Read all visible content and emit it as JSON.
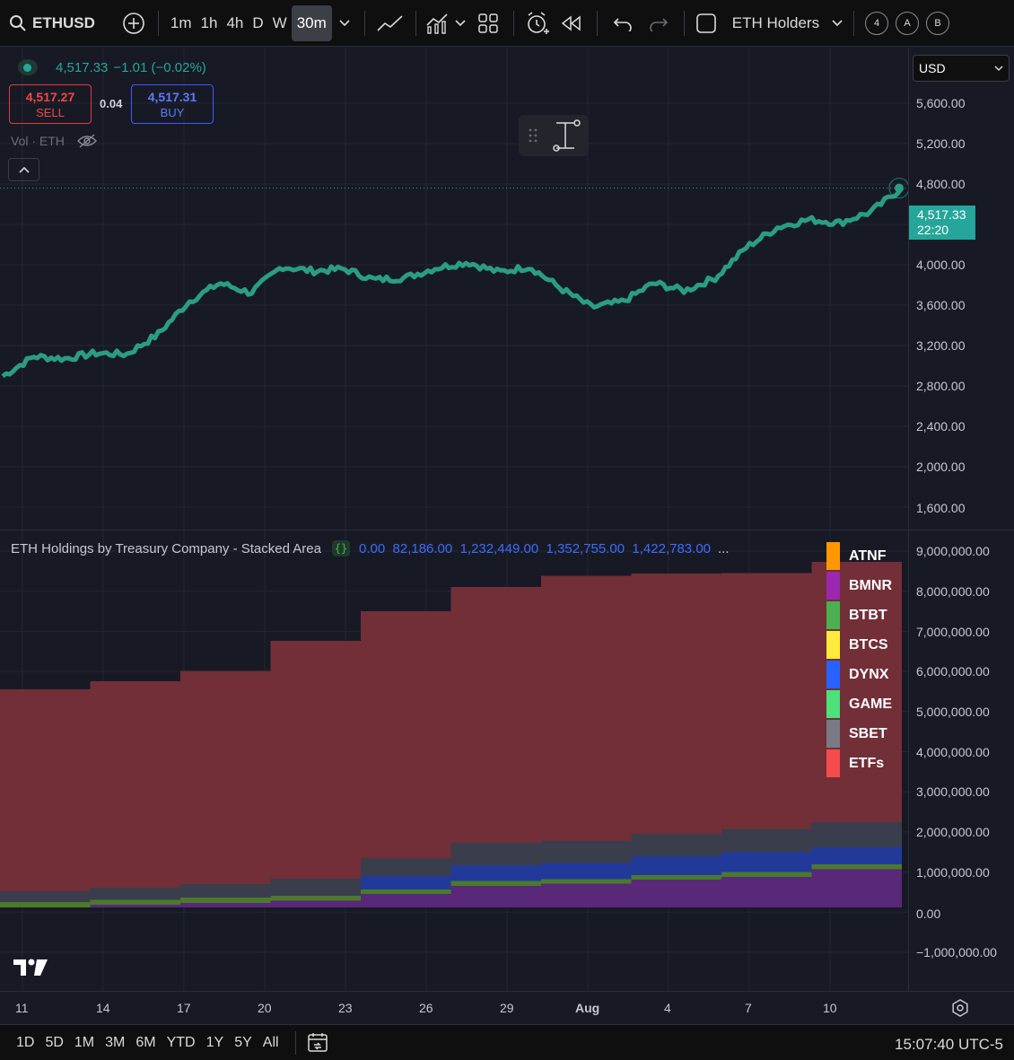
{
  "toolbar": {
    "symbol": "ETHUSD",
    "timeframes": [
      "1m",
      "1h",
      "4h",
      "D",
      "W",
      "30m"
    ],
    "active_timeframe": "30m",
    "layout_name": "ETH Holders",
    "alert_badges": [
      "4",
      "A",
      "B"
    ]
  },
  "legend": {
    "price": "4,517.33",
    "change": "−1.01 (−0.02%)",
    "sell_price": "4,517.27",
    "sell_label": "SELL",
    "spread": "0.04",
    "buy_price": "4,517.31",
    "buy_label": "BUY",
    "volume_label": "Vol · ETH"
  },
  "price_axis": {
    "currency": "USD",
    "ticks": [
      "5,600.00",
      "5,200.00",
      "4,800.00",
      "4,000.00",
      "3,600.00",
      "3,200.00",
      "2,800.00",
      "2,400.00",
      "2,000.00",
      "1,600.00"
    ],
    "last_price": "4,517.33",
    "countdown": "22:20"
  },
  "indicator": {
    "title": "ETH Holdings by Treasury Company - Stacked Area",
    "values": "0.00  82,186.00  1,232,449.00  1,352,755.00  1,422,783.00",
    "more": "...",
    "ticks": [
      "9,000,000.00",
      "8,000,000.00",
      "7,000,000.00",
      "6,000,000.00",
      "5,000,000.00",
      "4,000,000.00",
      "3,000,000.00",
      "2,000,000.00",
      "1,000,000.00",
      "0.00",
      "−1,000,000.00"
    ],
    "series": [
      {
        "name": "ATNF",
        "color": "#ff9800"
      },
      {
        "name": "BMNR",
        "color": "#9c27b0"
      },
      {
        "name": "BTBT",
        "color": "#4caf50"
      },
      {
        "name": "BTCS",
        "color": "#ffeb3b"
      },
      {
        "name": "DYNX",
        "color": "#2962ff"
      },
      {
        "name": "GAME",
        "color": "#4ee07a"
      },
      {
        "name": "SBET",
        "color": "#787b86"
      },
      {
        "name": "ETFs",
        "color": "#f44c4c"
      }
    ]
  },
  "date_axis": {
    "labels": [
      "11",
      "14",
      "17",
      "20",
      "23",
      "26",
      "29",
      "Aug",
      "4",
      "7",
      "10"
    ]
  },
  "bottom_bar": {
    "ranges": [
      "1D",
      "5D",
      "1M",
      "3M",
      "6M",
      "YTD",
      "1Y",
      "5Y",
      "All"
    ],
    "clock": "15:07:40 UTC-5"
  },
  "chart_data": [
    {
      "type": "line",
      "series": [
        {
          "values": [
            2800,
            2980,
            2960,
            3010,
            3000,
            3180,
            3480,
            3650,
            3560,
            3800,
            3760,
            3780,
            3680,
            3700,
            3790,
            3840,
            3750,
            3800,
            3600,
            3430,
            3480,
            3650,
            3580,
            3700,
            3980,
            4160,
            4230,
            4200,
            4300,
            4517
          ]
        }
      ],
      "ylim": [
        1400,
        5800
      ]
    },
    {
      "type": "area",
      "x": [
        "11",
        "14",
        "17",
        "20",
        "23",
        "26",
        "29",
        "Aug",
        "4",
        "7",
        "10"
      ],
      "series": [
        {
          "name": "BMNR",
          "values": [
            0,
            60000,
            100000,
            150000,
            300000,
            480000,
            530000,
            620000,
            680000,
            850000,
            1232449
          ]
        },
        {
          "name": "BTBT",
          "values": [
            120000,
            110000,
            120000,
            110000,
            100000,
            110000,
            100000,
            100000,
            110000,
            110000,
            120000
          ]
        },
        {
          "name": "DYNX",
          "values": [
            0,
            0,
            0,
            0,
            300000,
            350000,
            360000,
            420000,
            440000,
            380000,
            420000
          ]
        },
        {
          "name": "SBET",
          "values": [
            240000,
            270000,
            300000,
            380000,
            400000,
            500000,
            500000,
            500000,
            520000,
            560000,
            580000
          ]
        },
        {
          "name": "ETFs",
          "values": [
            4500000,
            4600000,
            4750000,
            5300000,
            5500000,
            5700000,
            5900000,
            5800000,
            5700000,
            5800000,
            6000000
          ]
        }
      ],
      "ylim": [
        -1000000,
        9000000
      ]
    }
  ]
}
